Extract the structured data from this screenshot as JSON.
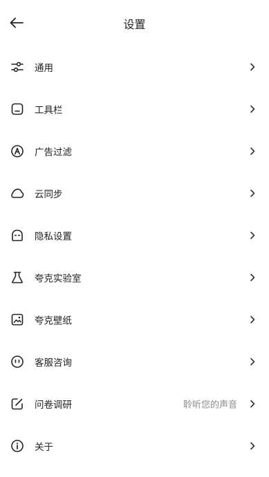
{
  "header": {
    "title": "设置",
    "back_icon": "arrow-left-icon"
  },
  "settings": {
    "items": [
      {
        "label": "通用",
        "icon": "sliders-icon"
      },
      {
        "label": "工具栏",
        "icon": "toolbar-icon"
      },
      {
        "label": "广告过滤",
        "icon": "ad-filter-icon"
      },
      {
        "label": "云同步",
        "icon": "cloud-icon"
      },
      {
        "label": "隐私设置",
        "icon": "privacy-icon"
      },
      {
        "label": "夸克实验室",
        "icon": "flask-icon"
      },
      {
        "label": "夸克壁纸",
        "icon": "wallpaper-icon"
      },
      {
        "label": "客服咨询",
        "icon": "customer-service-icon"
      },
      {
        "label": "问卷调研",
        "icon": "survey-icon",
        "value": "聆听您的声音"
      },
      {
        "label": "关于",
        "icon": "info-icon"
      }
    ]
  }
}
